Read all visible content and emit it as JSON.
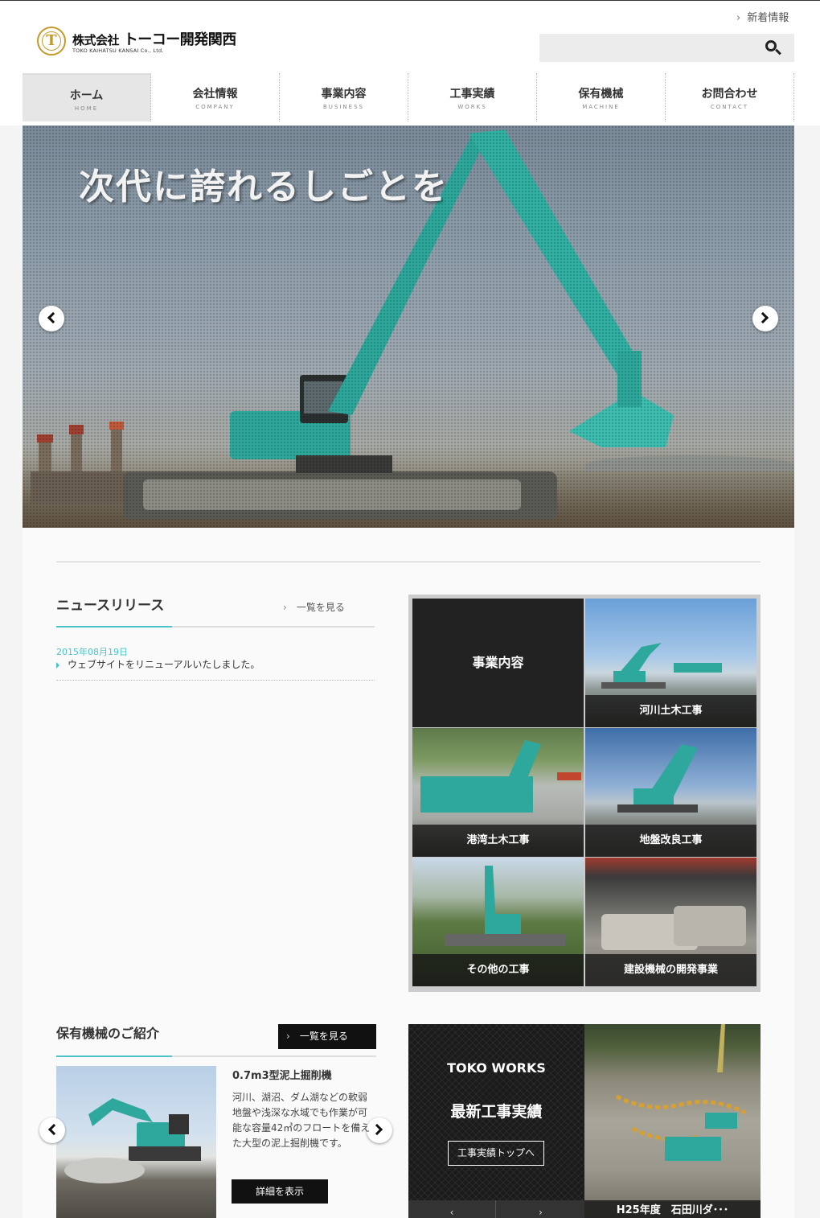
{
  "header": {
    "logo_company_prefix": "株式会社",
    "logo_company_name": "トーコー開発関西",
    "logo_subtitle": "TOKO KAIHATSU KANSAI Co., Ltd.",
    "logo_mark": "T",
    "news_link": "新着情報"
  },
  "nav": [
    {
      "jp": "ホーム",
      "en": "HOME"
    },
    {
      "jp": "会社情報",
      "en": "COMPANY"
    },
    {
      "jp": "事業内容",
      "en": "BUSINESS"
    },
    {
      "jp": "工事実績",
      "en": "WORKS"
    },
    {
      "jp": "保有機械",
      "en": "MACHINE"
    },
    {
      "jp": "お問合わせ",
      "en": "CONTACT"
    }
  ],
  "hero": {
    "title": "次代に誇れるしごとを"
  },
  "news": {
    "title": "ニュースリリース",
    "more": "一覧を見る",
    "items": [
      {
        "date": "2015年08月19日",
        "text": "ウェブサイトをリニューアルいたしました。"
      }
    ]
  },
  "business": {
    "heading": "事業内容",
    "cells": [
      "河川土木工事",
      "港湾土木工事",
      "地盤改良工事",
      "その他の工事",
      "建設機械の開発事業"
    ]
  },
  "machines": {
    "title": "保有機械のご紹介",
    "more": "一覧を見る",
    "item_name": "0.7m3型泥上掘削機",
    "item_desc": "河川、湖沼、ダム湖などの軟弱地盤や浅深な水域でも作業が可能な容量42㎥のフロートを備えた大型の泥上掘削機です。",
    "detail_button": "詳細を表示"
  },
  "works": {
    "en_title": "TOKO WORKS",
    "jp_title": "最新工事実績",
    "button": "工事実績トップへ",
    "caption": "H25年度　石田川ダ･･･",
    "prev": "‹",
    "next": "›"
  },
  "colors": {
    "accent": "#4cc3c7",
    "logo_gold": "#c59a2a",
    "excavator": "#2ea89c"
  }
}
